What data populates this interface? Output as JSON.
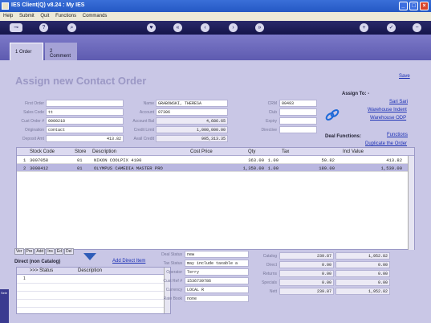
{
  "window": {
    "title": "IES Client(Q) v8.24 : My IES"
  },
  "menu": [
    "Help",
    "Submit",
    "Quit",
    "Functions",
    "Commands"
  ],
  "tabs": [
    {
      "label": "1 Order"
    },
    {
      "label": "2 Comment"
    }
  ],
  "page": {
    "title": "Assign new Contact Order",
    "save": "Save"
  },
  "form": {
    "first_order_label": "First Order",
    "first_order": "",
    "sales_code_label": "Sales Code",
    "sales_code": "tt",
    "cust_order_label": "Cust Order #",
    "cust_order": "0000218",
    "origination_label": "Origination",
    "origination": "contact",
    "deposit_amt_label": "Deposit Amt",
    "deposit_amt": "413.82",
    "name_label": "Name",
    "name": "GRABOWSKI, THERESA",
    "account_label": "Account",
    "account": "07306",
    "account_bal_label": "Account Bal",
    "account_bal": "4,686.65",
    "credit_limit_label": "Credit Limit",
    "credit_limit": "1,000,000.00",
    "avail_credit_label": "Avail Credit",
    "avail_credit": "995,313.35",
    "crm_label": "CRM",
    "crm": "00493",
    "club_label": "Club",
    "club": "",
    "expiry_label": "Expiry",
    "expiry": "",
    "directive_label": "Directive",
    "directive": ""
  },
  "assign": {
    "title": "Assign To: -",
    "links": [
      "Sari Sari",
      "Warehouse Indent",
      "Warehouse ODP"
    ]
  },
  "deal": {
    "title": "Deal Functions:",
    "links": [
      "Functions",
      "Duplicate the Order"
    ]
  },
  "grid": {
    "columns": [
      "Stock Code",
      "Store",
      "Description",
      "Cost Price",
      "Qty",
      "Tax",
      "Incl Value"
    ],
    "rows": [
      {
        "no": "1",
        "stock": "3007058",
        "store": "01",
        "desc": "NIKON COOLPIX 4100",
        "cost": "363.00",
        "qty": "1.00",
        "tax": "50.82",
        "incl": "413.82"
      },
      {
        "no": "2",
        "stock": "3008412",
        "store": "01",
        "desc": "OLYMPUS CAMEDIA MASTER PRO",
        "cost": "1,350.00",
        "qty": "1.00",
        "tax": "189.00",
        "incl": "1,539.00"
      }
    ]
  },
  "subtabs": [
    "Ver",
    "Pre",
    "Add",
    "Ins",
    "Ed",
    "Del"
  ],
  "direct": {
    "title": "Direct (non Catalog)",
    "add_link": "Add Direct Item",
    "columns": [
      ">>> Status",
      "Description"
    ],
    "row_no": "1"
  },
  "info": {
    "deal_status_label": "Deal Status",
    "deal_status": "new",
    "tax_status_label": "Tax Status",
    "tax_status": "may include taxable a",
    "operator_label": "Operator",
    "operator": "Terry",
    "cust_ref_label": "Cust Ref #",
    "cust_ref": "1536739786",
    "currency_label": "Currency",
    "currency": "LOCAL R",
    "rate_book_label": "Rate Book",
    "rate_book": "none"
  },
  "totals": [
    {
      "label": "Catalog",
      "a": "239.87",
      "b": "1,952.82"
    },
    {
      "label": "Direct",
      "a": "0.00",
      "b": "0.00"
    },
    {
      "label": "Returns",
      "a": "0.00",
      "b": "0.00"
    },
    {
      "label": "Specials",
      "a": "0.00",
      "b": "0.00"
    },
    {
      "label": "Nett",
      "a": "239.87",
      "b": "1,952.82"
    }
  ],
  "sidebar_label": "Sele"
}
